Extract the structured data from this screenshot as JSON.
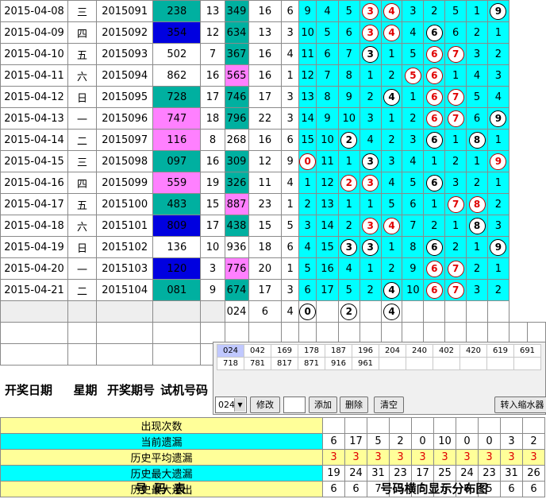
{
  "rows": [
    {
      "date": "2015-04-08",
      "wk": "三",
      "period": "2015091",
      "trial": "238",
      "sum1": "13",
      "draw": "349",
      "sum2": "16",
      "span": "6",
      "tc": "teal",
      "dc": "teal",
      "cells": [
        "9",
        "4",
        "5",
        {
          "b": "3",
          "c": "r"
        },
        {
          "b": "4",
          "c": "r"
        },
        "3",
        "2",
        "5",
        "1",
        {
          "b": "9",
          "c": "k"
        }
      ]
    },
    {
      "date": "2015-04-09",
      "wk": "四",
      "period": "2015092",
      "trial": "354",
      "sum1": "12",
      "draw": "634",
      "sum2": "13",
      "span": "3",
      "tc": "blue",
      "dc": "teal",
      "cells": [
        "10",
        "5",
        "6",
        {
          "b": "3",
          "c": "r"
        },
        {
          "b": "4",
          "c": "r"
        },
        "4",
        {
          "b": "6",
          "c": "k"
        },
        "6",
        "2",
        "1"
      ]
    },
    {
      "date": "2015-04-10",
      "wk": "五",
      "period": "2015093",
      "trial": "502",
      "sum1": "7",
      "draw": "367",
      "sum2": "16",
      "span": "4",
      "tc": "none",
      "dc": "teal",
      "cells": [
        "11",
        "6",
        "7",
        {
          "b": "3",
          "c": "k"
        },
        "1",
        "5",
        {
          "b": "6",
          "c": "r"
        },
        {
          "b": "7",
          "c": "r"
        },
        "3",
        "2"
      ]
    },
    {
      "date": "2015-04-11",
      "wk": "六",
      "period": "2015094",
      "trial": "862",
      "sum1": "16",
      "draw": "565",
      "sum2": "16",
      "span": "1",
      "tc": "none",
      "dc": "pink",
      "cells": [
        "12",
        "7",
        "8",
        "1",
        "2",
        {
          "b": "5",
          "c": "r"
        },
        {
          "b": "6",
          "c": "r"
        },
        "1",
        "4",
        "3"
      ]
    },
    {
      "date": "2015-04-12",
      "wk": "日",
      "period": "2015095",
      "trial": "728",
      "sum1": "17",
      "draw": "746",
      "sum2": "17",
      "span": "3",
      "tc": "teal",
      "dc": "teal",
      "cells": [
        "13",
        "8",
        "9",
        "2",
        {
          "b": "4",
          "c": "k"
        },
        "1",
        {
          "b": "6",
          "c": "r"
        },
        {
          "b": "7",
          "c": "r"
        },
        "5",
        "4"
      ]
    },
    {
      "date": "2015-04-13",
      "wk": "一",
      "period": "2015096",
      "trial": "747",
      "sum1": "18",
      "draw": "796",
      "sum2": "22",
      "span": "3",
      "tc": "pink",
      "dc": "teal",
      "cells": [
        "14",
        "9",
        "10",
        "3",
        "1",
        "2",
        {
          "b": "6",
          "c": "r"
        },
        {
          "b": "7",
          "c": "r"
        },
        "6",
        {
          "b": "9",
          "c": "k"
        }
      ]
    },
    {
      "date": "2015-04-14",
      "wk": "二",
      "period": "2015097",
      "trial": "116",
      "sum1": "8",
      "draw": "268",
      "sum2": "16",
      "span": "6",
      "tc": "pink",
      "dc": "none",
      "cells": [
        "15",
        "10",
        {
          "b": "2",
          "c": "k"
        },
        "4",
        "2",
        "3",
        {
          "b": "6",
          "c": "k"
        },
        "1",
        {
          "b": "8",
          "c": "k"
        },
        "1"
      ]
    },
    {
      "date": "2015-04-15",
      "wk": "三",
      "period": "2015098",
      "trial": "097",
      "sum1": "16",
      "draw": "309",
      "sum2": "12",
      "span": "9",
      "tc": "teal",
      "dc": "teal",
      "cells": [
        {
          "b": "0",
          "c": "r"
        },
        "11",
        "1",
        {
          "b": "3",
          "c": "k"
        },
        "3",
        "4",
        "1",
        "2",
        "1",
        {
          "b": "9",
          "c": "r"
        }
      ]
    },
    {
      "date": "2015-04-16",
      "wk": "四",
      "period": "2015099",
      "trial": "559",
      "sum1": "19",
      "draw": "326",
      "sum2": "11",
      "span": "4",
      "tc": "pink",
      "dc": "teal",
      "cells": [
        "1",
        "12",
        {
          "b": "2",
          "c": "r"
        },
        {
          "b": "3",
          "c": "r"
        },
        "4",
        "5",
        {
          "b": "6",
          "c": "k"
        },
        "3",
        "2",
        "1"
      ]
    },
    {
      "date": "2015-04-17",
      "wk": "五",
      "period": "2015100",
      "trial": "483",
      "sum1": "15",
      "draw": "887",
      "sum2": "23",
      "span": "1",
      "tc": "teal",
      "dc": "pink",
      "cells": [
        "2",
        "13",
        "1",
        "1",
        "5",
        "6",
        "1",
        {
          "b": "7",
          "c": "r"
        },
        {
          "b": "8",
          "c": "r"
        },
        "2"
      ]
    },
    {
      "date": "2015-04-18",
      "wk": "六",
      "period": "2015101",
      "trial": "809",
      "sum1": "17",
      "draw": "438",
      "sum2": "15",
      "span": "5",
      "tc": "blue",
      "dc": "teal",
      "cells": [
        "3",
        "14",
        "2",
        {
          "b": "3",
          "c": "r"
        },
        {
          "b": "4",
          "c": "r"
        },
        "7",
        "2",
        "1",
        {
          "b": "8",
          "c": "k"
        },
        "3"
      ]
    },
    {
      "date": "2015-04-19",
      "wk": "日",
      "period": "2015102",
      "trial": "136",
      "sum1": "10",
      "draw": "936",
      "sum2": "18",
      "span": "6",
      "tc": "none",
      "dc": "none",
      "cells": [
        "4",
        "15",
        {
          "b": "3",
          "c": "k"
        },
        {
          "b": "3",
          "c": "k"
        },
        "1",
        "8",
        {
          "b": "6",
          "c": "k"
        },
        "2",
        "1",
        {
          "b": "9",
          "c": "k"
        }
      ]
    },
    {
      "date": "2015-04-20",
      "wk": "一",
      "period": "2015103",
      "trial": "120",
      "sum1": "3",
      "draw": "776",
      "sum2": "20",
      "span": "1",
      "tc": "blue",
      "dc": "pink",
      "cells": [
        "5",
        "16",
        "4",
        "1",
        "2",
        "9",
        {
          "b": "6",
          "c": "r"
        },
        {
          "b": "7",
          "c": "r"
        },
        "2",
        "1"
      ]
    },
    {
      "date": "2015-04-21",
      "wk": "二",
      "period": "2015104",
      "trial": "081",
      "sum1": "9",
      "draw": "674",
      "sum2": "17",
      "span": "3",
      "tc": "teal",
      "dc": "teal",
      "cells": [
        "6",
        "17",
        "5",
        "2",
        {
          "b": "4",
          "c": "k"
        },
        "10",
        {
          "b": "6",
          "c": "r"
        },
        {
          "b": "7",
          "c": "r"
        },
        "3",
        "2"
      ]
    }
  ],
  "summary": {
    "draw": "024",
    "sum": "6",
    "span": "4",
    "balls": [
      "0",
      "",
      "2",
      "",
      "4",
      "",
      "",
      "",
      "",
      ""
    ]
  },
  "popup": {
    "row1": [
      "024",
      "042",
      "169",
      "178",
      "187",
      "196",
      "204",
      "240",
      "402",
      "420",
      "619",
      "691"
    ],
    "row2": [
      "718",
      "781",
      "817",
      "871",
      "916",
      "961"
    ],
    "select_value": "024",
    "modify": "修改",
    "add": "添加",
    "delete": "删除",
    "clear": "清空",
    "transfer": "转入缩水器"
  },
  "headers": {
    "date": "开奖日期",
    "week": "星期",
    "period": "开奖期号",
    "trial": "试机号码"
  },
  "stats": [
    {
      "label": "出现次数",
      "style": "yel",
      "values": [
        "",
        "",
        "",
        "",
        "",
        "",
        "",
        "",
        "",
        ""
      ]
    },
    {
      "label": "当前遗漏",
      "style": "cyb",
      "values": [
        "6",
        "17",
        "5",
        "2",
        "0",
        "10",
        "0",
        "0",
        "3",
        "2"
      ]
    },
    {
      "label": "历史平均遗漏",
      "style": "yel",
      "values": [
        "3",
        "3",
        "3",
        "3",
        "3",
        "3",
        "3",
        "3",
        "3",
        "3"
      ]
    },
    {
      "label": "历史最大遗漏",
      "style": "cyb",
      "values": [
        "19",
        "24",
        "31",
        "23",
        "17",
        "25",
        "24",
        "23",
        "31",
        "26"
      ]
    },
    {
      "label": "历史最大连出",
      "style": "yel",
      "values": [
        "6",
        "6",
        "7",
        "5",
        "5",
        "6",
        "6",
        "5",
        "6",
        "6"
      ]
    }
  ],
  "footer": {
    "left": "号   码   表",
    "right": "号码横向显示分布图"
  }
}
